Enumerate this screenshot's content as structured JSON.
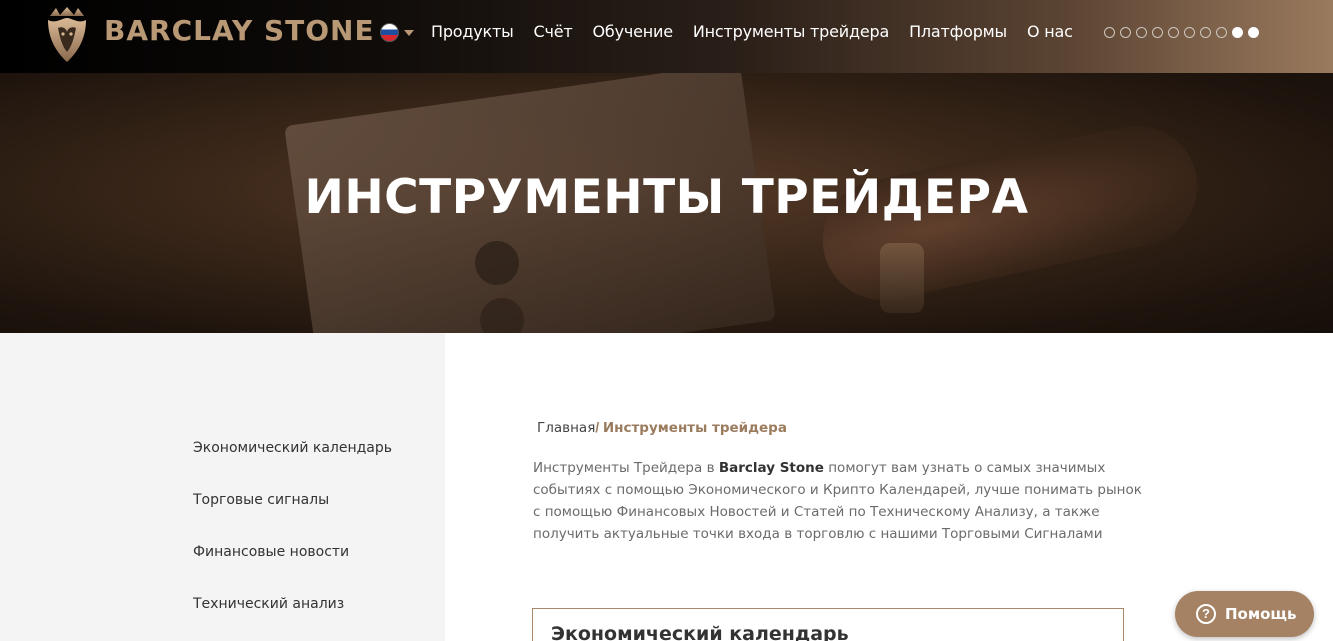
{
  "header": {
    "brand": "BARCLAY STONE",
    "language_flag": "ru",
    "nav": [
      "Продукты",
      "Счёт",
      "Обучение",
      "Инструменты трейдера",
      "Платформы",
      "О нас"
    ],
    "slider_dots_count": 10,
    "slider_active_dots": [
      8,
      9
    ]
  },
  "hero": {
    "title": "ИНСТРУМЕНТЫ ТРЕЙДЕРА"
  },
  "sidebar": {
    "items": [
      "Экономический календарь",
      "Торговые сигналы",
      "Финансовые новости",
      "Технический анализ"
    ]
  },
  "breadcrumb": {
    "home": "Главная",
    "separator": "/",
    "current": "Инструменты трейдера"
  },
  "intro": {
    "prefix": "Инструменты Трейдера в ",
    "brand": "Barclay Stone",
    "suffix": " помогут вам узнать о самых значимых событиях с помощью Экономического и Крипто Календарей, лучше понимать рынок с помощью Финансовых Новостей и Статей по Техническому Анализу, а также получить актуальные точки входа в торговлю с нашими Торговыми Сигналами"
  },
  "card": {
    "title": "Экономический календарь"
  },
  "help": {
    "icon_text": "?",
    "label": "Помощь"
  },
  "colors": {
    "accent": "#a48263",
    "brand": "#b99876"
  }
}
